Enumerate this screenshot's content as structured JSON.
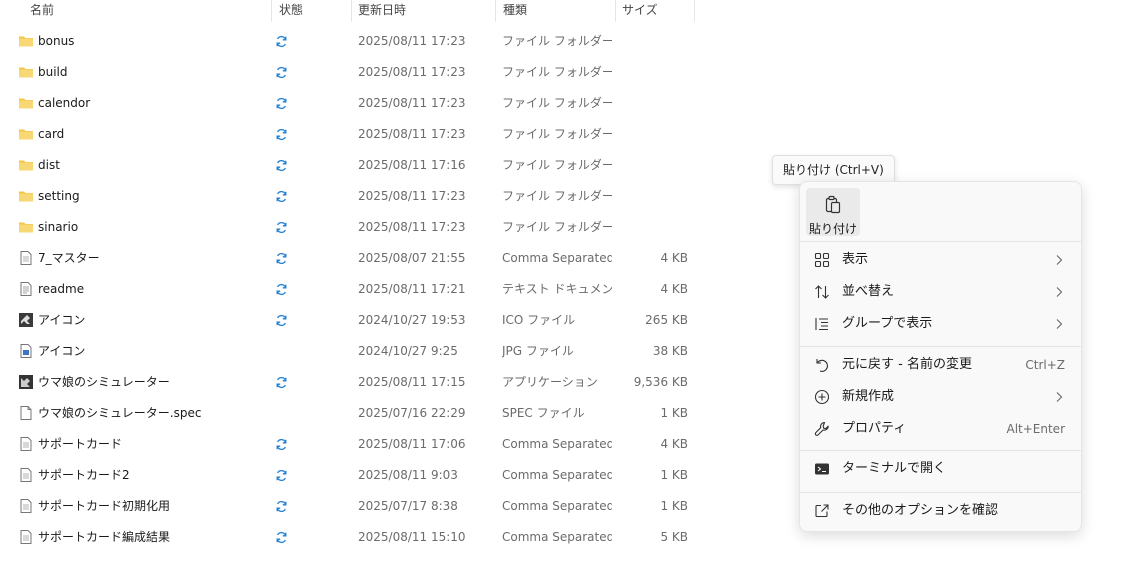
{
  "columns": {
    "name": "名前",
    "status": "状態",
    "modified": "更新日時",
    "type": "種類",
    "size": "サイズ"
  },
  "files": [
    {
      "name": "bonus",
      "icon": "folder-icon",
      "sync": true,
      "date": "2025/08/11 17:23",
      "type": "ファイル フォルダー",
      "size": ""
    },
    {
      "name": "build",
      "icon": "folder-icon",
      "sync": true,
      "date": "2025/08/11 17:23",
      "type": "ファイル フォルダー",
      "size": ""
    },
    {
      "name": "calendor",
      "icon": "folder-icon",
      "sync": true,
      "date": "2025/08/11 17:23",
      "type": "ファイル フォルダー",
      "size": ""
    },
    {
      "name": "card",
      "icon": "folder-icon",
      "sync": true,
      "date": "2025/08/11 17:23",
      "type": "ファイル フォルダー",
      "size": ""
    },
    {
      "name": "dist",
      "icon": "folder-icon",
      "sync": true,
      "date": "2025/08/11 17:16",
      "type": "ファイル フォルダー",
      "size": ""
    },
    {
      "name": "setting",
      "icon": "folder-icon",
      "sync": true,
      "date": "2025/08/11 17:23",
      "type": "ファイル フォルダー",
      "size": ""
    },
    {
      "name": "sinario",
      "icon": "folder-icon",
      "sync": true,
      "date": "2025/08/11 17:23",
      "type": "ファイル フォルダー",
      "size": ""
    },
    {
      "name": "7_マスター",
      "icon": "csv-file-icon",
      "sync": true,
      "date": "2025/08/07 21:55",
      "type": "Comma Separated...",
      "size": "4 KB"
    },
    {
      "name": "readme",
      "icon": "text-file-icon",
      "sync": true,
      "date": "2025/08/11 17:21",
      "type": "テキスト ドキュメント",
      "size": "4 KB"
    },
    {
      "name": "アイコン",
      "icon": "ico-file-icon",
      "sync": true,
      "date": "2024/10/27 19:53",
      "type": "ICO ファイル",
      "size": "265 KB"
    },
    {
      "name": "アイコン",
      "icon": "jpg-file-icon",
      "sync": false,
      "date": "2024/10/27 9:25",
      "type": "JPG ファイル",
      "size": "38 KB"
    },
    {
      "name": "ウマ娘のシミュレーター",
      "icon": "app-file-icon",
      "sync": true,
      "date": "2025/08/11 17:15",
      "type": "アプリケーション",
      "size": "9,536 KB"
    },
    {
      "name": "ウマ娘のシミュレーター.spec",
      "icon": "blank-file-icon",
      "sync": false,
      "date": "2025/07/16 22:29",
      "type": "SPEC ファイル",
      "size": "1 KB"
    },
    {
      "name": "サポートカード",
      "icon": "csv-file-icon",
      "sync": true,
      "date": "2025/08/11 17:06",
      "type": "Comma Separated...",
      "size": "4 KB"
    },
    {
      "name": "サポートカード2",
      "icon": "csv-file-icon",
      "sync": true,
      "date": "2025/08/11 9:03",
      "type": "Comma Separated...",
      "size": "1 KB"
    },
    {
      "name": "サポートカード初期化用",
      "icon": "csv-file-icon",
      "sync": true,
      "date": "2025/07/17 8:38",
      "type": "Comma Separated...",
      "size": "1 KB"
    },
    {
      "name": "サポートカード編成結果",
      "icon": "csv-file-icon",
      "sync": true,
      "date": "2025/08/11 15:10",
      "type": "Comma Separated...",
      "size": "5 KB"
    }
  ],
  "tooltip": "貼り付け (Ctrl+V)",
  "menu": {
    "paste_label": "貼り付け",
    "items": [
      {
        "name": "menu-item-view",
        "icon": "grid-icon",
        "label": "表示",
        "shortcut": "",
        "submenu": true
      },
      {
        "name": "menu-item-sort",
        "icon": "sort-icon",
        "label": "並べ替え",
        "shortcut": "",
        "submenu": true
      },
      {
        "name": "menu-item-group",
        "icon": "group-list-icon",
        "label": "グループで表示",
        "shortcut": "",
        "submenu": true
      },
      {
        "name": "menu-item-undo",
        "icon": "undo-icon",
        "label": "元に戻す - 名前の変更",
        "shortcut": "Ctrl+Z",
        "submenu": false
      },
      {
        "name": "menu-item-new",
        "icon": "plus-circle-icon",
        "label": "新規作成",
        "shortcut": "",
        "submenu": true
      },
      {
        "name": "menu-item-properties",
        "icon": "wrench-icon",
        "label": "プロパティ",
        "shortcut": "Alt+Enter",
        "submenu": false
      },
      {
        "name": "menu-item-terminal",
        "icon": "terminal-icon",
        "label": "ターミナルで開く",
        "shortcut": "",
        "submenu": false
      },
      {
        "name": "menu-item-more-options",
        "icon": "share-box-icon",
        "label": "その他のオプションを確認",
        "shortcut": "",
        "submenu": false
      }
    ]
  },
  "colors": {
    "folder": "#F4C542",
    "sync_icon": "#1E7FD1",
    "menu_bg": "#F9F9F9"
  }
}
